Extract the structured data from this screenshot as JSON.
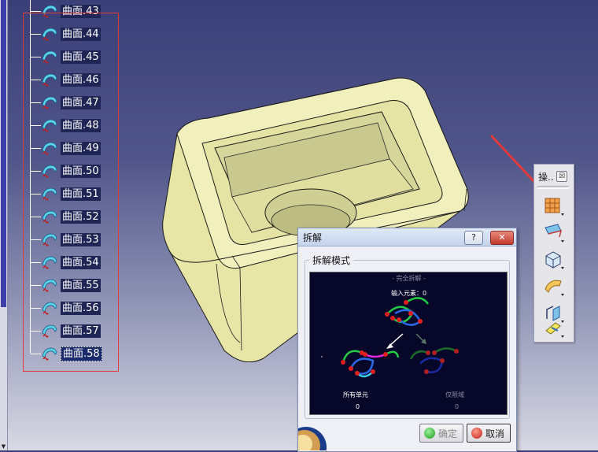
{
  "tree": {
    "items": [
      {
        "label": "曲面.43"
      },
      {
        "label": "曲面.44"
      },
      {
        "label": "曲面.45"
      },
      {
        "label": "曲面.46"
      },
      {
        "label": "曲面.47"
      },
      {
        "label": "曲面.48"
      },
      {
        "label": "曲面.49"
      },
      {
        "label": "曲面.50"
      },
      {
        "label": "曲面.51"
      },
      {
        "label": "曲面.52"
      },
      {
        "label": "曲面.53"
      },
      {
        "label": "曲面.54"
      },
      {
        "label": "曲面.55"
      },
      {
        "label": "曲面.56"
      },
      {
        "label": "曲面.57"
      },
      {
        "label": "曲面.58"
      }
    ],
    "selected_index": 15
  },
  "toolbar": {
    "title": "操..",
    "close_glyph": "☒",
    "buttons": [
      {
        "icon": "disassemble-icon"
      },
      {
        "icon": "boundary-icon"
      },
      {
        "icon": "extract-icon"
      },
      {
        "icon": "multiple-extract-icon"
      },
      {
        "icon": "split-icon"
      },
      {
        "icon": "trim-icon"
      }
    ]
  },
  "dialog": {
    "title": "拆解",
    "help_glyph": "?",
    "close_glyph": "✕",
    "group_label": "拆解模式",
    "preview": {
      "mode_title": "- 完全拆解 -",
      "input_label": "输入元素：0",
      "all_domains_label": "所有单元",
      "all_domains_value": "0",
      "domain_only_label": "仅限域",
      "domain_only_value": "0"
    },
    "ok_label": "确定",
    "cancel_label": "取消"
  },
  "colors": {
    "viewport_top": "#3a3f78",
    "part_fill": "#e9e8a8",
    "selection_box": "#e23a3a",
    "preview_bg": "#07072a"
  }
}
